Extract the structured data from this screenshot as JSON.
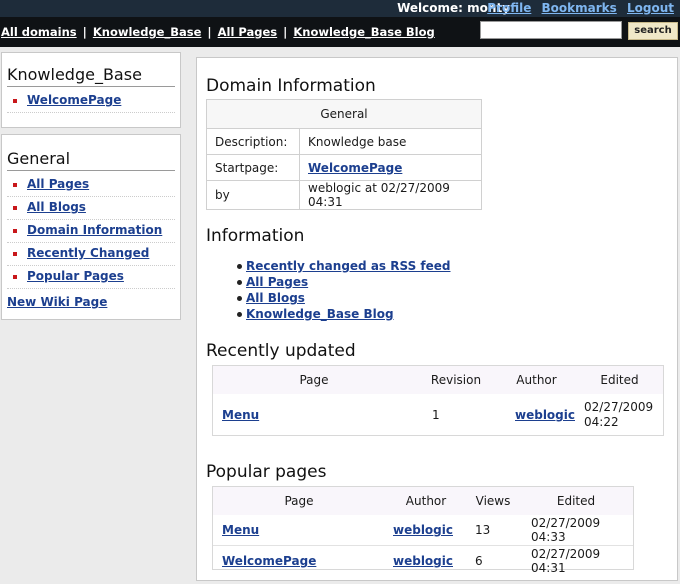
{
  "topbar": {
    "welcome": "Welcome: monty",
    "links": [
      "Profile",
      "Bookmarks",
      "Logout"
    ]
  },
  "navbar": {
    "crumbs": [
      "All domains",
      "Knowledge_Base",
      "All Pages",
      "Knowledge_Base Blog"
    ],
    "separator": "|",
    "search_value": "",
    "search_button": "search"
  },
  "sidebar": {
    "domain_box": {
      "title": "Knowledge_Base",
      "items": [
        "WelcomePage"
      ]
    },
    "general_box": {
      "title": "General",
      "items": [
        "All Pages",
        "All Blogs",
        "Domain Information",
        "Recently Changed",
        "Popular Pages"
      ],
      "new_page": "New Wiki Page"
    }
  },
  "main": {
    "domain_info": {
      "heading": "Domain Information",
      "table_header": "General",
      "rows": [
        {
          "key": "Description:",
          "value": "Knowledge base"
        },
        {
          "key": "Startpage:",
          "value": "WelcomePage"
        },
        {
          "key": "by",
          "value": "weblogic at 02/27/2009 04:31"
        }
      ]
    },
    "information": {
      "heading": "Information",
      "links": [
        "Recently changed as RSS feed",
        "All Pages",
        "All Blogs",
        "Knowledge_Base Blog"
      ]
    },
    "recent": {
      "heading": "Recently updated",
      "columns": [
        "Page",
        "Revision",
        "Author",
        "Edited"
      ],
      "rows": [
        {
          "page": "Menu",
          "revision": "1",
          "author": "weblogic",
          "edited_date": "02/27/2009",
          "edited_time": "04:22"
        }
      ]
    },
    "popular": {
      "heading": "Popular pages",
      "columns": [
        "Page",
        "Author",
        "Views",
        "Edited"
      ],
      "rows": [
        {
          "page": "Menu",
          "author": "weblogic",
          "views": "13",
          "edited": "02/27/2009 04:33"
        },
        {
          "page": "WelcomePage",
          "author": "weblogic",
          "views": "6",
          "edited": "02/27/2009 04:31"
        }
      ]
    }
  }
}
